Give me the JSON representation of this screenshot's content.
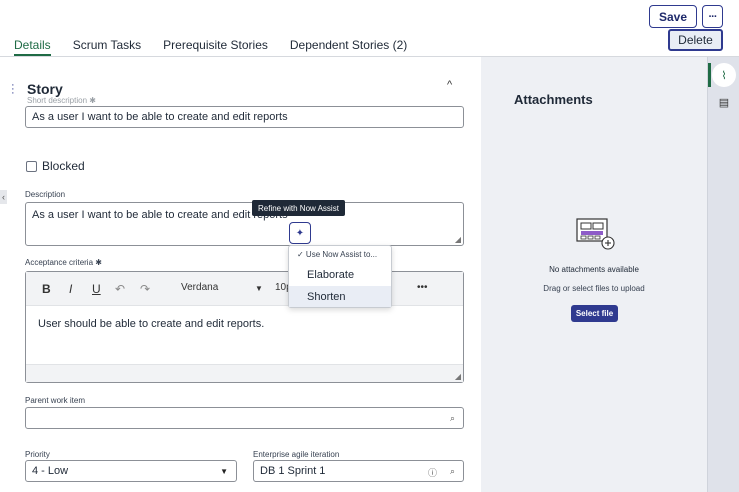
{
  "header": {
    "save_label": "Save",
    "more_label": "···",
    "delete_label": "Delete"
  },
  "tabs": [
    {
      "label": "Details"
    },
    {
      "label": "Scrum Tasks"
    },
    {
      "label": "Prerequisite Stories"
    },
    {
      "label": "Dependent Stories (2)"
    }
  ],
  "section": {
    "title": "Story",
    "ghost_label": "Short description ✱"
  },
  "short_description": {
    "value": "As a user I want to be able to create and edit reports"
  },
  "blocked": {
    "label": "Blocked"
  },
  "description": {
    "label": "Description",
    "value": "As a user I want to be able to create and edit reports"
  },
  "tooltip": {
    "text": "Refine with Now Assist"
  },
  "assist_menu": {
    "header": "✓ Use Now Assist to...",
    "items": [
      "Elaborate",
      "Shorten"
    ]
  },
  "acceptance": {
    "label": "Acceptance criteria ✱",
    "toolbar": {
      "bold": "B",
      "italic": "I",
      "underline": "U",
      "undo": "↶",
      "redo": "↷",
      "font": "Verdana",
      "size": "10p",
      "more": "•••"
    },
    "value": "User should be able to create and edit reports."
  },
  "parent_work_item": {
    "label": "Parent work item",
    "value": ""
  },
  "priority": {
    "label": "Priority",
    "value": "4 - Low"
  },
  "iteration": {
    "label": "Enterprise agile iteration",
    "value": "DB 1 Sprint 1"
  },
  "attachments": {
    "title": "Attachments",
    "empty_title": "No attachments available",
    "empty_sub": "Drag or select files to upload",
    "select_label": "Select file"
  },
  "colors": {
    "accent": "#2f3a8f",
    "active_tab": "#1f6b45",
    "panel_bg": "#eef0f4"
  }
}
